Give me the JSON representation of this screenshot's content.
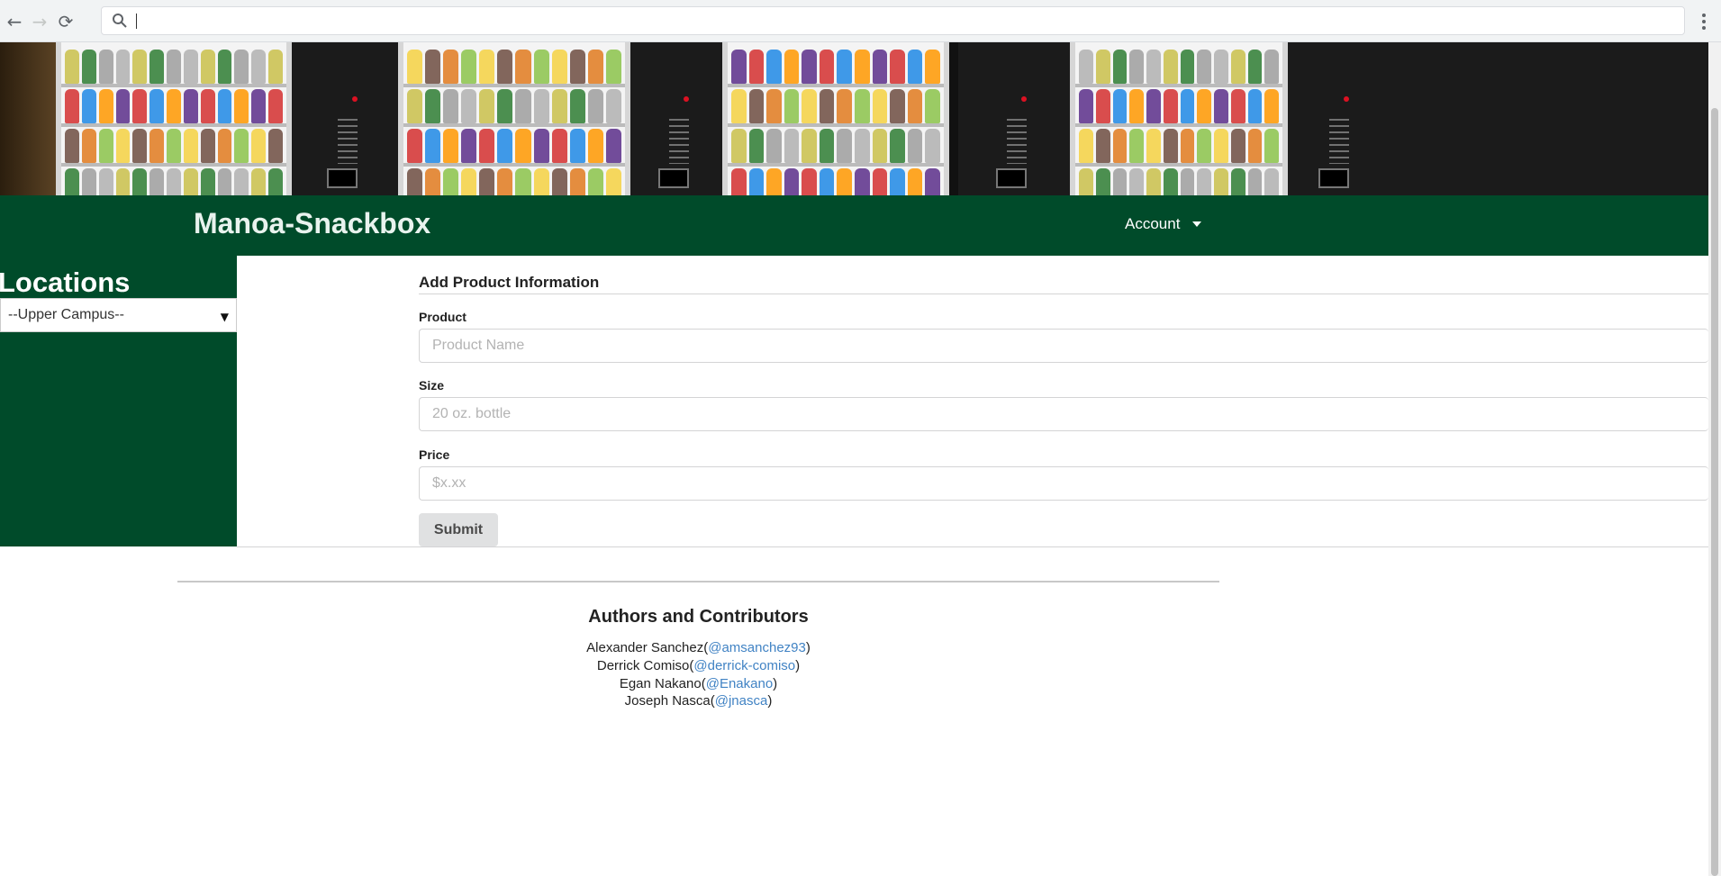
{
  "browser": {
    "back_glyph": "←",
    "forward_glyph": "→",
    "reload_glyph": "⟳",
    "icons": [
      "back-arrow-icon",
      "forward-arrow-icon",
      "reload-icon",
      "search-icon",
      "more-vert-icon"
    ]
  },
  "navbar": {
    "brand": "Manoa-Snackbox",
    "account_label": "Account",
    "color": "#004b2a"
  },
  "sidebar": {
    "title": "Locations",
    "select_value": "--Upper Campus--",
    "arrow_glyph": "▼"
  },
  "form": {
    "title": "Add Product Information",
    "fields": [
      {
        "label": "Product",
        "placeholder": "Product Name"
      },
      {
        "label": "Size",
        "placeholder": "20 oz. bottle"
      },
      {
        "label": "Price",
        "placeholder": "$x.xx"
      }
    ],
    "submit_label": "Submit"
  },
  "footer": {
    "title": "Authors and Contributors",
    "authors": [
      {
        "name": "Alexander Sanchez(",
        "handle": "@amsanchez93",
        "close": ")"
      },
      {
        "name": "Derrick Comiso(",
        "handle": "@derrick-comiso",
        "close": ")"
      },
      {
        "name": "Egan Nakano(",
        "handle": "@Enakano",
        "close": ")"
      },
      {
        "name": "Joseph Nasca(",
        "handle": "@jnasca",
        "close": ")"
      }
    ],
    "link_color": "#4183c4"
  }
}
